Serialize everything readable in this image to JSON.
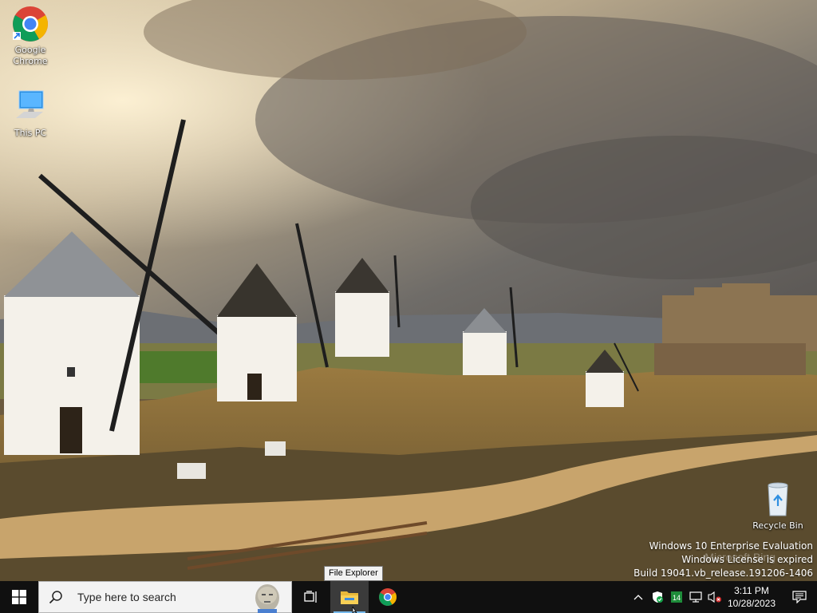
{
  "desktop": {
    "icons": [
      {
        "label": "Google Chrome",
        "icon": "chrome-icon"
      },
      {
        "label": "This PC",
        "icon": "computer-icon"
      },
      {
        "label": "Recycle Bin",
        "icon": "recycle-bin-icon"
      }
    ],
    "wallpaper": {
      "subject": "windmills-wallpaper",
      "watermark": "Microsoft Bing"
    }
  },
  "watermark": {
    "line1": "Windows 10 Enterprise Evaluation",
    "line2": "Windows License is expired",
    "line3": "Build 19041.vb_release.191206-1406"
  },
  "tooltip": {
    "text": "File Explorer"
  },
  "taskbar": {
    "search_placeholder": "Type here to search",
    "pinned": [
      {
        "name": "Task View",
        "icon": "task-view-icon"
      },
      {
        "name": "File Explorer",
        "icon": "folder-icon",
        "active": true
      },
      {
        "name": "Google Chrome",
        "icon": "chrome-icon"
      }
    ],
    "tray": {
      "badge_count": "14",
      "icons": [
        "chevron-up-icon",
        "security-shield-icon",
        "excel-icon",
        "network-icon",
        "volume-muted-icon"
      ]
    },
    "clock": {
      "time": "3:11 PM",
      "date": "10/28/2023"
    },
    "colors": {
      "taskbar_bg": "#101010",
      "accent": "#76b9ed"
    }
  }
}
